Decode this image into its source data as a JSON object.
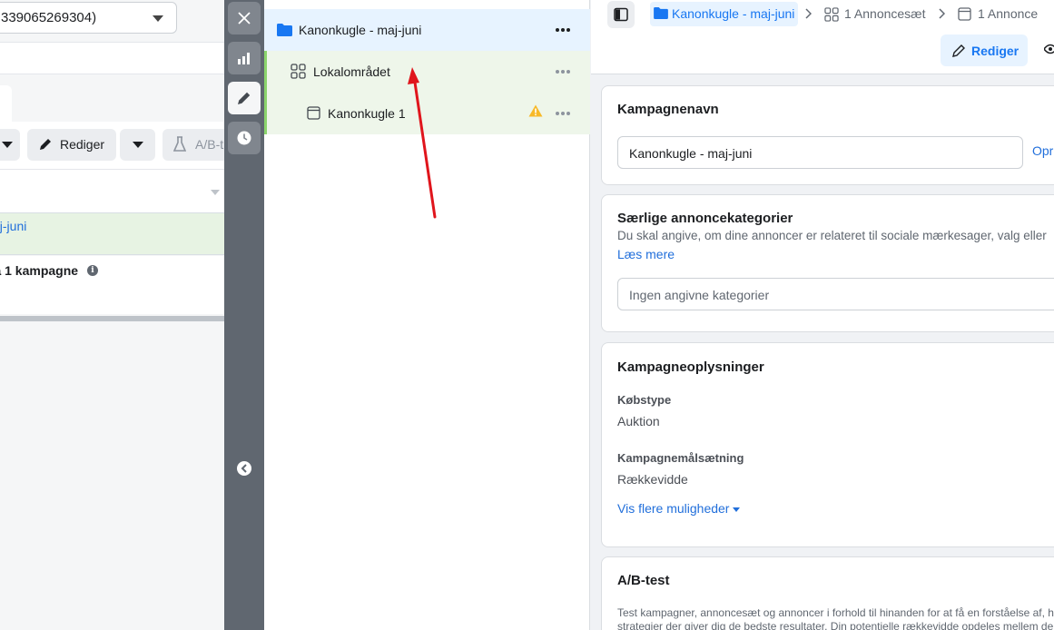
{
  "left_panel": {
    "account_selector_text": "339065269304)",
    "edit_label": "Rediger",
    "ab_test_label": "A/B-t",
    "campaign_row_text": "aj-juni",
    "summary_text": "ra 1 kampagne"
  },
  "tree": {
    "campaign": "Kanonkugle - maj-juni",
    "adset": "Lokalområdet",
    "ad": "Kanonkugle 1"
  },
  "breadcrumb": {
    "campaign": "Kanonkugle - maj-juni",
    "adsets": "1 Annoncesæt",
    "ads": "1 Annonce"
  },
  "actions": {
    "edit_label": "Rediger"
  },
  "campaign_name_card": {
    "title": "Kampagnenavn",
    "input_value": "Kanonkugle - maj-juni",
    "side_link": "Opre"
  },
  "special_categories_card": {
    "title": "Særlige annoncekategorier",
    "description": "Du skal angive, om dine annoncer er relateret til sociale mærkesager, valg eller",
    "learn_more": "Læs mere",
    "placeholder": "Ingen angivne kategorier"
  },
  "campaign_details_card": {
    "title": "Kampagneoplysninger",
    "buying_type_label": "Købstype",
    "buying_type_value": "Auktion",
    "objective_label": "Kampagnemålsætning",
    "objective_value": "Rækkevidde",
    "more_options": "Vis flere muligheder"
  },
  "ab_test_card": {
    "title": "A/B-test",
    "line1": "Test kampagner, annoncesæt og annoncer i forhold til hinanden for at få en forståelse af, h",
    "line2": "strategier der giver dig de bedste resultater. Din potentielle rækkevidde opdeles mellem der"
  },
  "colors": {
    "accent": "#1877f2",
    "selected_row": "#e7f3ff",
    "adset_row": "#eef6ea",
    "annotation_arrow": "#e0151c",
    "warning": "#f7b928"
  },
  "icons": [
    "folder-icon",
    "adset-grid-icon",
    "ad-icon",
    "warning-icon",
    "more-dots-icon",
    "close-icon",
    "chart-icon",
    "pencil-icon",
    "clock-icon",
    "collapse-chevron-icon",
    "sidebar-toggle-icon",
    "eye-icon"
  ]
}
